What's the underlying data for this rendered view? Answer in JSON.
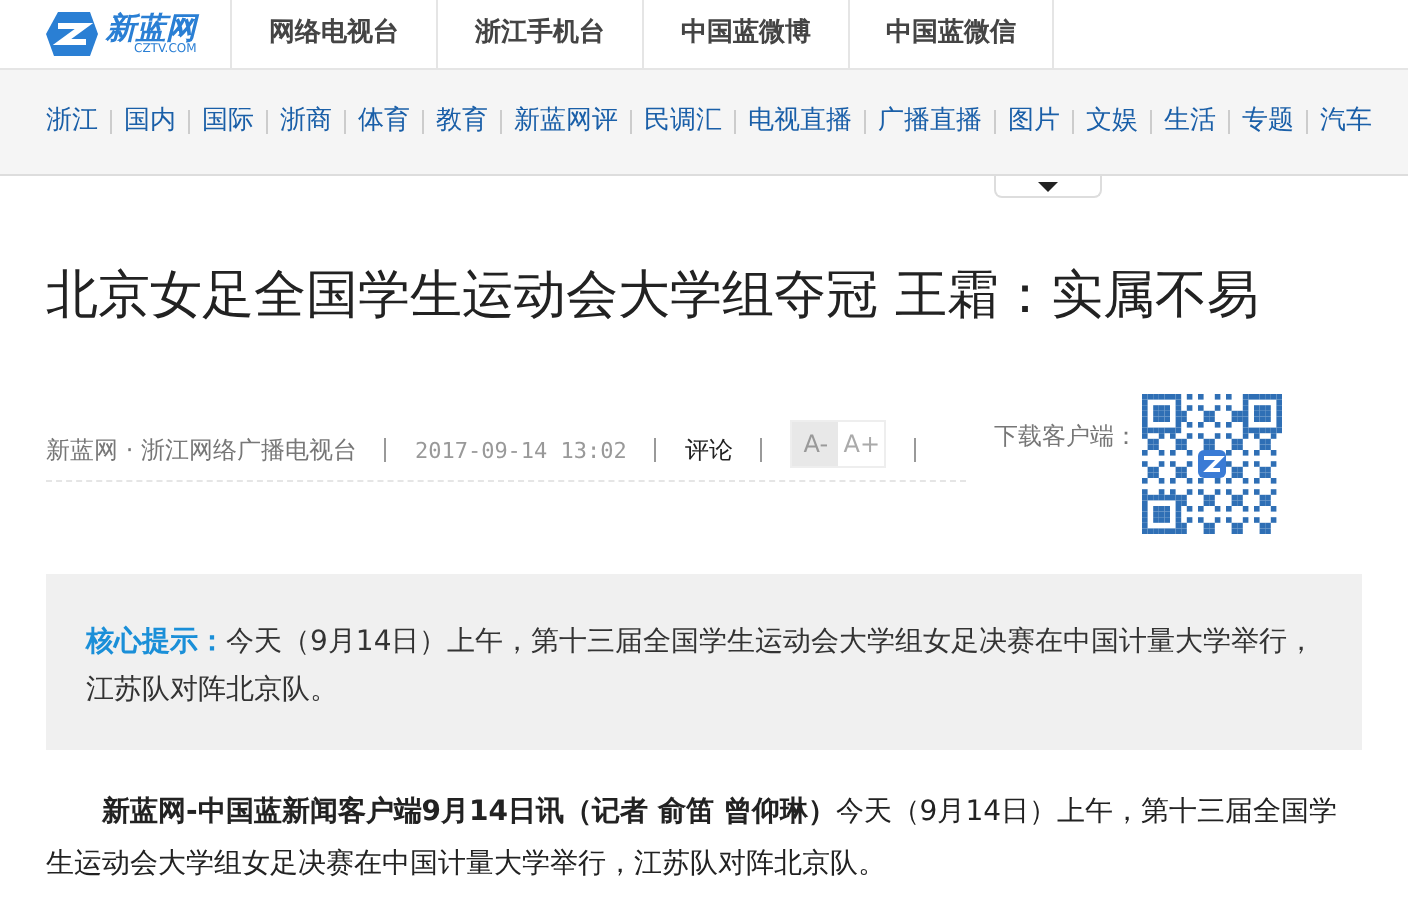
{
  "logo": {
    "name": "新蓝网",
    "domain": "CZTV.COM"
  },
  "top_links": [
    "网络电视台",
    "浙江手机台",
    "中国蓝微博",
    "中国蓝微信"
  ],
  "nav": [
    "浙江",
    "国内",
    "国际",
    "浙商",
    "体育",
    "教育",
    "新蓝网评",
    "民调汇",
    "电视直播",
    "广播直播",
    "图片",
    "文娱",
    "生活",
    "专题",
    "汽车"
  ],
  "article": {
    "title": "北京女足全国学生运动会大学组夺冠 王霜：实属不易",
    "source": "新蓝网 · 浙江网络广播电视台",
    "date": "2017-09-14 13:02",
    "comment": "评论",
    "font_buttons": [
      {
        "label": "A-",
        "selected": true
      },
      {
        "label": "A+",
        "selected": false
      }
    ],
    "download_label": "下载客户端：",
    "summary": {
      "label": "核心提示：",
      "text": "今天（9月14日）上午，第十三届全国学生运动会大学组女足决赛在中国计量大学举行，江苏队对阵北京队。"
    },
    "body": "**新蓝网-中国蓝新闻客户端9月14日讯（记者 俞笛 曾仰琳）**今天（9月14日）上午，第十三届全国学生运动会大学组女足决赛在中国计量大学举行，江苏队对阵北京队。"
  }
}
